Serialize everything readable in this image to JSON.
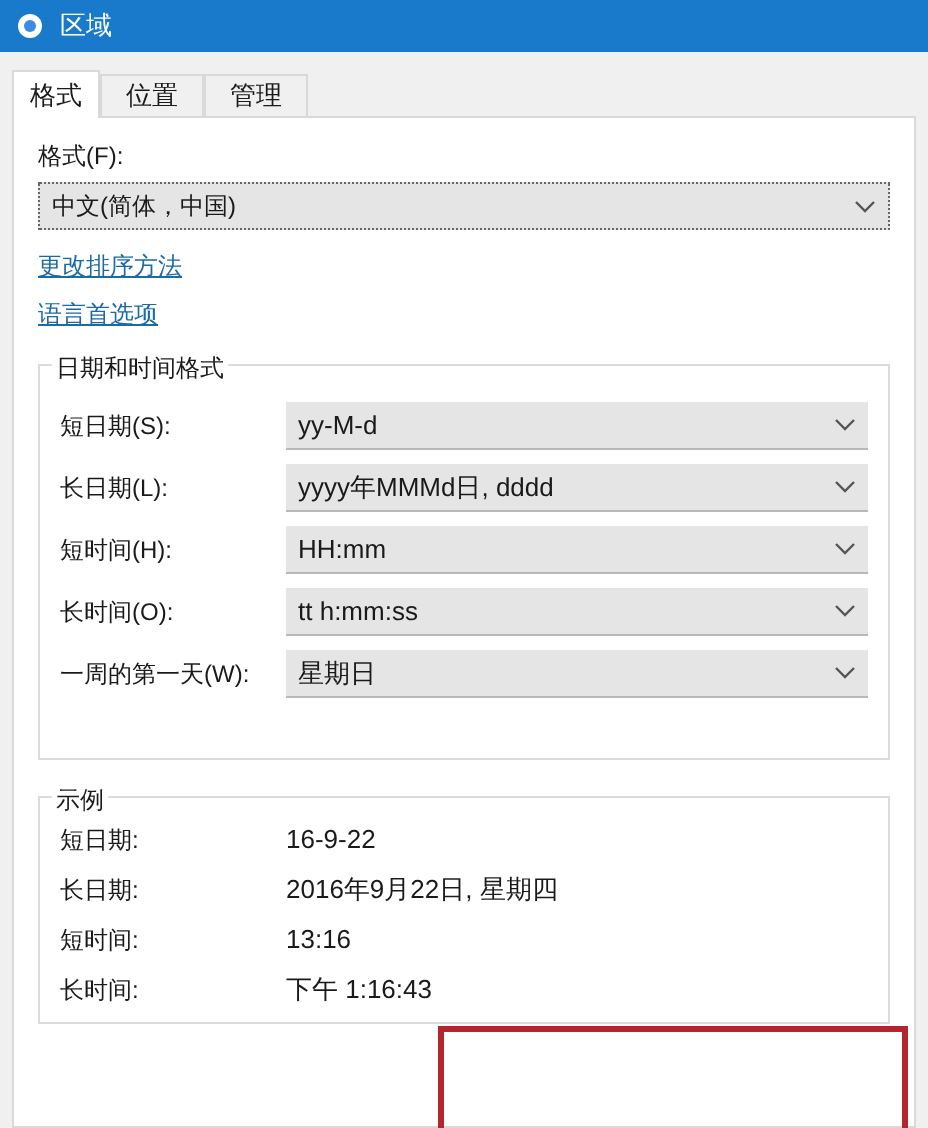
{
  "window": {
    "title": "区域"
  },
  "tabs": [
    {
      "label": "格式",
      "selected": true
    },
    {
      "label": "位置",
      "selected": false
    },
    {
      "label": "管理",
      "selected": false
    }
  ],
  "format": {
    "label": "格式(F):",
    "value": "中文(简体，中国)"
  },
  "links": [
    "更改排序方法",
    "语言首选项"
  ],
  "datetime_group": {
    "title": "日期和时间格式",
    "rows": [
      {
        "label": "短日期(S):",
        "value": "yy-M-d"
      },
      {
        "label": "长日期(L):",
        "value": "yyyy年MMMd日, dddd"
      },
      {
        "label": "短时间(H):",
        "value": "HH:mm"
      },
      {
        "label": "长时间(O):",
        "value": "tt h:mm:ss"
      },
      {
        "label": "一周的第一天(W):",
        "value": "星期日"
      }
    ]
  },
  "example_group": {
    "title": "示例",
    "rows": [
      {
        "label": "短日期:",
        "value": "16-9-22"
      },
      {
        "label": "长日期:",
        "value": "2016年9月22日, 星期四"
      },
      {
        "label": "短时间:",
        "value": "13:16"
      },
      {
        "label": "长时间:",
        "value": "下午 1:16:43"
      }
    ]
  }
}
